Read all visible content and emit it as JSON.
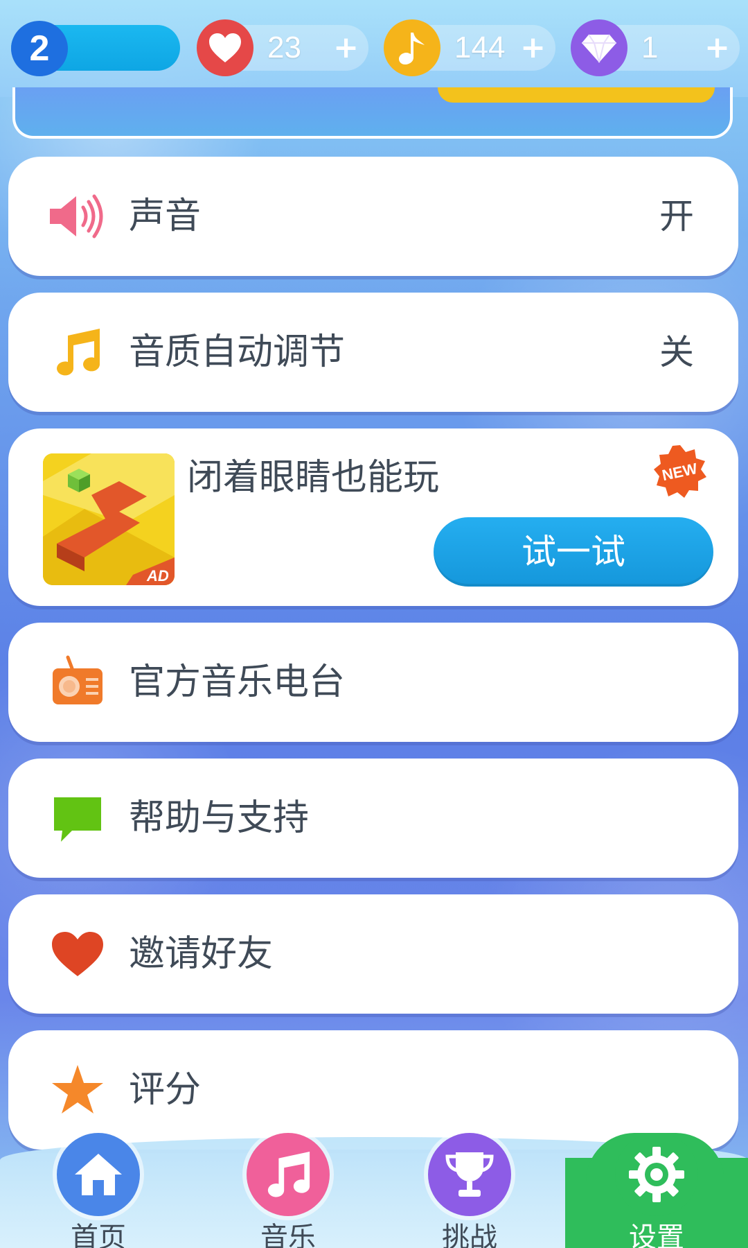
{
  "colors": {
    "accent_blue": "#1597db",
    "heart_red": "#e54848",
    "note_gold": "#f5b41a",
    "gem_purple": "#8d5ce6",
    "level_blue": "#1e6fe0",
    "active_tab_green": "#2fbd5b",
    "text_dark": "#3f4a57"
  },
  "topbar": {
    "level": "2",
    "lives": {
      "value": "23",
      "plus": "+",
      "icon": "heart-icon"
    },
    "notes": {
      "value": "144",
      "plus": "+",
      "icon": "music-note-icon"
    },
    "gems": {
      "value": "1",
      "plus": "+",
      "icon": "diamond-icon"
    }
  },
  "settings": {
    "sound": {
      "label": "声音",
      "value": "开",
      "icon": "speaker-icon"
    },
    "auto_quality": {
      "label": "音质自动调节",
      "value": "关",
      "icon": "music-notes-icon"
    },
    "ad": {
      "title": "闭着眼睛也能玩",
      "badge": "NEW",
      "thumb_tag": "AD",
      "button": "试一试"
    },
    "radio": {
      "label": "官方音乐电台",
      "icon": "radio-icon"
    },
    "help": {
      "label": "帮助与支持",
      "icon": "chat-bubble-icon"
    },
    "invite": {
      "label": "邀请好友",
      "icon": "heart-icon"
    },
    "rate": {
      "label": "评分",
      "icon": "star-icon"
    }
  },
  "nav": {
    "items": [
      {
        "label": "首页",
        "icon": "home-icon"
      },
      {
        "label": "音乐",
        "icon": "music-notes-icon"
      },
      {
        "label": "挑战",
        "icon": "trophy-icon"
      },
      {
        "label": "设置",
        "icon": "gear-icon"
      }
    ],
    "active_index": 3
  }
}
